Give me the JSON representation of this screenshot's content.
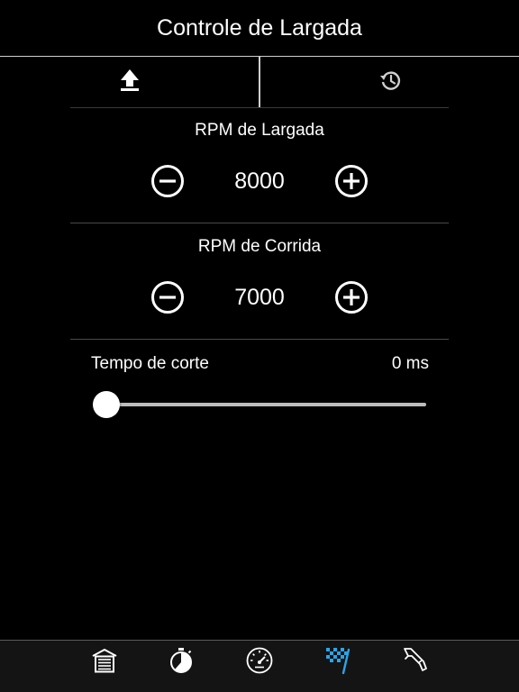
{
  "header": {
    "title": "Controle de Largada"
  },
  "toolbar": {
    "upload_icon": "upload-icon",
    "history_icon": "history-icon"
  },
  "launch_rpm": {
    "label": "RPM de Largada",
    "value": "8000",
    "decrement_icon": "minus-circle-icon",
    "increment_icon": "plus-circle-icon"
  },
  "race_rpm": {
    "label": "RPM de Corrida",
    "value": "7000",
    "decrement_icon": "minus-circle-icon",
    "increment_icon": "plus-circle-icon"
  },
  "cut_time": {
    "label": "Tempo de corte",
    "value": "0 ms",
    "slider_fraction": 0
  },
  "tabbar": {
    "items": [
      {
        "icon": "garage-icon",
        "active": false
      },
      {
        "icon": "stopwatch-icon",
        "active": false
      },
      {
        "icon": "gauge-icon",
        "active": false
      },
      {
        "icon": "race-flag-icon",
        "active": true
      },
      {
        "icon": "fuel-nozzle-icon",
        "active": false
      }
    ],
    "active_color": "#2aa5e6",
    "inactive_color": "#ffffff"
  }
}
